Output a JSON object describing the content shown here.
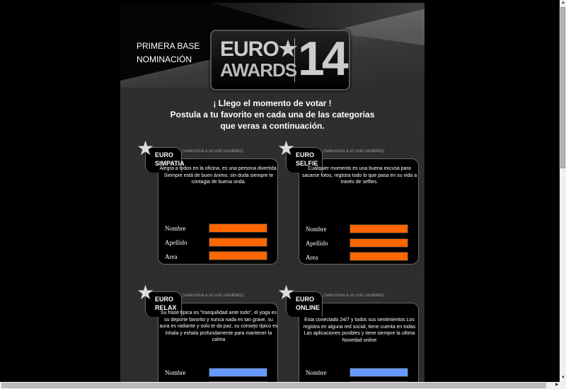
{
  "header": {
    "line1": "PRIMERA BASE",
    "line2": "NOMINACIÓN"
  },
  "logo": {
    "euro": "EURO★",
    "awards": "AWARDS",
    "number": "14"
  },
  "intro": {
    "line1": "¡ Llego el momento de votar !",
    "line2": "Postula  a tu favorito  en cada una de las categorias",
    "line3": "que veras a continuación."
  },
  "cards": [
    {
      "t1": "EURO",
      "t2": "SIMPATIA",
      "note": "(selecciona a un solo candidato)",
      "desc": "Alegra a todos en la oficina, es una persona divertida. Siempre está de buen ánimo, sin duda siempre te contagia de buena onda.",
      "labels": [
        "Nombre",
        "Apellido",
        "Area"
      ],
      "color": "#ff6600"
    },
    {
      "t1": "EURO",
      "t2": "SELFIE",
      "note": "(selecciona a un solo candidato)",
      "desc": "Cualquier momento es una buena excusa para sacarse fotos, registra todo lo que pasa en su vida a través de selfies.",
      "labels": [
        "Nombre",
        "Apellido",
        "Area"
      ],
      "color": "#ff6600"
    },
    {
      "t1": "EURO",
      "t2": "RELAX",
      "note": "(selecciona a un solo candidato)",
      "desc": "Su frase típica es \"tranquilidad ante todo\", el yoga es su deporte favorito y nunca nada es tan grave, su aura es radiante y solo te da paz, su consejo típico es  inhala y exhala profundamente  para mantener la calma",
      "labels": [
        "Nombre"
      ],
      "color": "#6699ff"
    },
    {
      "t1": "EURO",
      "t2": "ONLINE",
      "note": "(selecciona a un solo candidato)",
      "desc": "Esta  conectado 24/7 y todos sus sentimientos Los registra en alguna red social, tiene cuenta en todas Las aplicaciones posibles y tiene  siempre la ultima Novedad  online",
      "labels": [
        "Nombre"
      ],
      "color": "#6699ff"
    }
  ]
}
